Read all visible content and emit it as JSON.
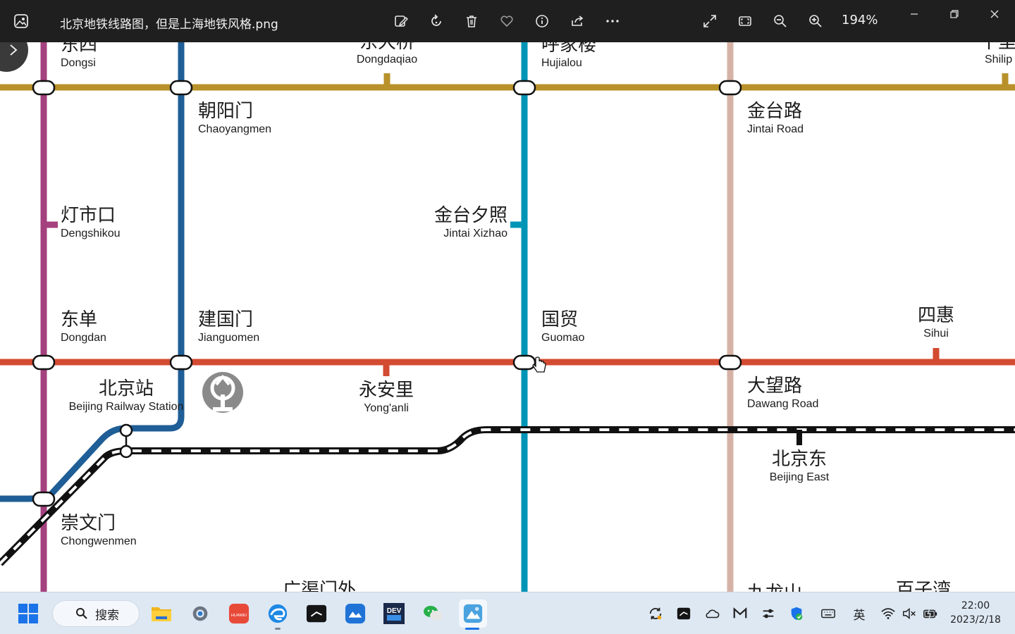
{
  "window": {
    "title": "北京地铁线路图，但是上海地铁风格.png",
    "zoom": "194%"
  },
  "map": {
    "stations": [
      {
        "id": "dongsi",
        "zh": "东四",
        "en": "Dongsi"
      },
      {
        "id": "dongdaqiao",
        "zh": "东大桥",
        "en": "Dongdaqiao"
      },
      {
        "id": "hujialou",
        "zh": "呼家楼",
        "en": "Hujialou"
      },
      {
        "id": "shilipu",
        "zh": "十里",
        "en": "Shilip"
      },
      {
        "id": "chaoyangmen",
        "zh": "朝阳门",
        "en": "Chaoyangmen"
      },
      {
        "id": "jintai-road",
        "zh": "金台路",
        "en": "Jintai Road"
      },
      {
        "id": "dengshikou",
        "zh": "灯市口",
        "en": "Dengshikou"
      },
      {
        "id": "jintai-xizhao",
        "zh": "金台夕照",
        "en": "Jintai Xizhao"
      },
      {
        "id": "dongdan",
        "zh": "东单",
        "en": "Dongdan"
      },
      {
        "id": "jianguomen",
        "zh": "建国门",
        "en": "Jianguomen"
      },
      {
        "id": "guomao",
        "zh": "国贸",
        "en": "Guomao"
      },
      {
        "id": "sihui",
        "zh": "四惠",
        "en": "Sihui"
      },
      {
        "id": "beijing-railway",
        "zh": "北京站",
        "en": "Beijing Railway Station"
      },
      {
        "id": "yonganli",
        "zh": "永安里",
        "en": "Yong'anli"
      },
      {
        "id": "dawang-road",
        "zh": "大望路",
        "en": "Dawang Road"
      },
      {
        "id": "beijing-east",
        "zh": "北京东",
        "en": "Beijing East"
      },
      {
        "id": "chongwenmen",
        "zh": "崇文门",
        "en": "Chongwenmen"
      },
      {
        "id": "guangqumenwai",
        "zh": "广渠门外",
        "en": ""
      },
      {
        "id": "jiulongshan",
        "zh": "九龙山",
        "en": ""
      },
      {
        "id": "baiziwan",
        "zh": "百子湾",
        "en": ""
      }
    ],
    "line_colors": {
      "line5": "#a4417f",
      "line2": "#1f5e96",
      "line10": "#0095b6",
      "line6": "#b8912a",
      "line14": "#d6b2a6",
      "line1": "#d34b32",
      "rail": "#111111"
    }
  },
  "taskbar": {
    "search_label": "搜索",
    "ime": "英",
    "time": "22:00",
    "date": "2023/2/18"
  }
}
